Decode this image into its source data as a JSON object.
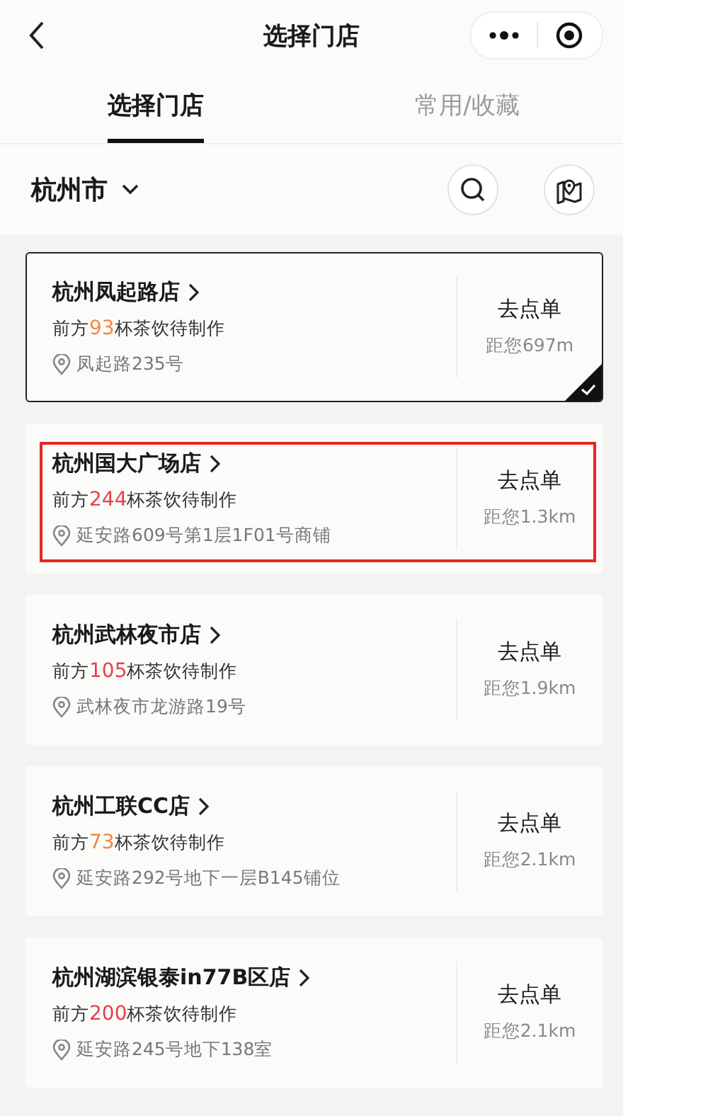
{
  "nav_bar": {
    "title": "选择门店"
  },
  "tabs": [
    {
      "label": "选择门店",
      "selected": true
    },
    {
      "label": "常用/收藏",
      "selected": false
    }
  ],
  "city": {
    "label": "杭州市"
  },
  "stores": [
    {
      "name": "杭州凤起路店",
      "queue_prefix": "前方",
      "queue_count": "93",
      "queue_suffix": "杯茶饮待制作",
      "color": "#ef8a45",
      "address": "凤起路235号",
      "action": "去点单",
      "distance": "距您697m",
      "selected": true,
      "highlighted": false
    },
    {
      "name": "杭州国大广场店",
      "queue_prefix": "前方",
      "queue_count": "244",
      "queue_suffix": "杯茶饮待制作",
      "color": "#e8404c",
      "address": "延安路609号第1层1F01号商铺",
      "action": "去点单",
      "distance": "距您1.3km",
      "selected": false,
      "highlighted": true
    },
    {
      "name": "杭州武林夜市店",
      "queue_prefix": "前方",
      "queue_count": "105",
      "queue_suffix": "杯茶饮待制作",
      "color": "#e8404c",
      "address": "武林夜市龙游路19号",
      "action": "去点单",
      "distance": "距您1.9km",
      "selected": false,
      "highlighted": false
    },
    {
      "name": "杭州工联CC店",
      "queue_prefix": "前方",
      "queue_count": "73",
      "queue_suffix": "杯茶饮待制作",
      "color": "#ef8a45",
      "address": "延安路292号地下一层B145铺位",
      "action": "去点单",
      "distance": "距您2.1km",
      "selected": false,
      "highlighted": false
    },
    {
      "name": "杭州湖滨银泰in77B区店",
      "queue_prefix": "前方",
      "queue_count": "200",
      "queue_suffix": "杯茶饮待制作",
      "color": "#e8404c",
      "address": "延安路245号地下138室",
      "action": "去点单",
      "distance": "距您2.1km",
      "selected": false,
      "highlighted": false
    }
  ]
}
